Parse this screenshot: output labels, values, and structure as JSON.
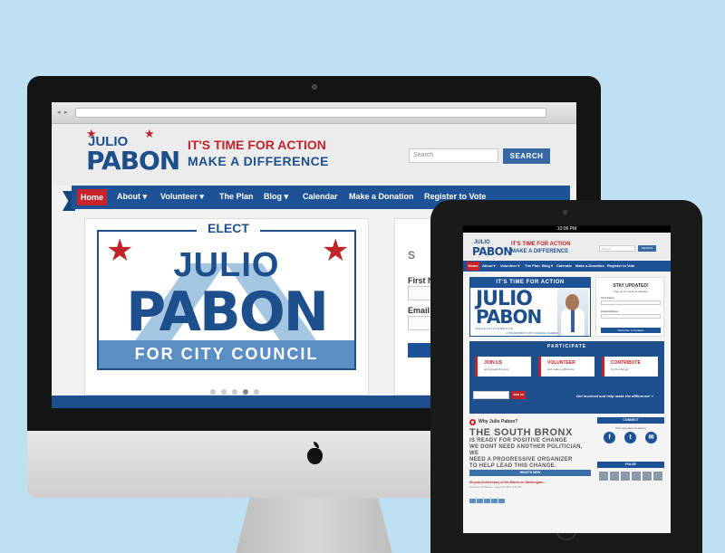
{
  "desktop": {
    "logo": {
      "line1": "JULIO",
      "line2": "PABON"
    },
    "tagline": {
      "line1": "IT'S TIME FOR ACTION",
      "line2": "MAKE A DIFFERENCE"
    },
    "search": {
      "placeholder": "Search",
      "button": "SEARCH"
    },
    "nav": [
      {
        "label": "Home"
      },
      {
        "label": "About ▾"
      },
      {
        "label": "Volunteer ▾"
      },
      {
        "label": "The Plan"
      },
      {
        "label": "Blog ▾"
      },
      {
        "label": "Calendar"
      },
      {
        "label": "Make a Donation"
      },
      {
        "label": "Register to Vote"
      }
    ],
    "hero": {
      "elect": "ELECT",
      "name1": "JULIO",
      "name2": "PABON",
      "council": "FOR CITY COUNCIL"
    },
    "form": {
      "first_name": "First N",
      "email": "Email A",
      "side_initial": "S"
    }
  },
  "tablet": {
    "status_time": "10:06 PM",
    "logo": {
      "line1": "JULIO",
      "line2": "PABON"
    },
    "tagline": {
      "line1": "IT'S TIME FOR ACTION",
      "line2": "MAKE A DIFFERENCE"
    },
    "search": {
      "placeholder": "Search",
      "button": "SEARCH"
    },
    "nav": [
      {
        "label": "Home"
      },
      {
        "label": "About ▾"
      },
      {
        "label": "Volunteer ▾"
      },
      {
        "label": "The Plan"
      },
      {
        "label": "Blog ▾"
      },
      {
        "label": "Calendar"
      },
      {
        "label": "Make a Donation"
      },
      {
        "label": "Register to Vote"
      }
    ],
    "hero": {
      "banner": "IT'S TIME FOR ACTION",
      "name1": "JULIO",
      "name2": "PABON",
      "sub": "M A K E   A   D I F F E R E N C E",
      "candidate": "17TH DISTRICT CITY COUNCIL CANDIDATE"
    },
    "updates": {
      "title": "STAY UPDATED!",
      "subtitle": "Sign up for News & Updates",
      "first_name": "First Name",
      "email": "Email Address",
      "button": "Subscribe to Updates"
    },
    "participate": {
      "title": "PARTICIPATE",
      "cards": [
        {
          "title": "JOIN US",
          "sub": "and spread the word"
        },
        {
          "title": "VOLUNTEER",
          "sub": "and make a difference"
        },
        {
          "title": "CONTRIBUTE",
          "sub": "for the change"
        }
      ],
      "join_button": "JOIN US",
      "involved": "Get involved and help make the difference! »"
    },
    "why": {
      "title": "Why Julio Pabon?",
      "headline": "THE SOUTH BRONX",
      "lines": [
        "IS READY FOR POSITIVE CHANGE",
        "WE DONT NEED ANOTHER POLITICIAN, WE",
        "NEED A PROGRESSIVE ORGANIZER",
        "TO HELP LEAD THIS CHANGE."
      ]
    },
    "whats_new": {
      "title": "WHAT'S NEW",
      "article": "50-year Anniversary of the March on Washington...",
      "meta": "Posted by Sal Rahman · August 28, 2013 11:57 PM"
    },
    "connect": {
      "title": "CONNECT",
      "sub": "Five new ways on saving",
      "icons": [
        "f",
        "t",
        "✉"
      ]
    },
    "pulse": {
      "title": "PULSE"
    }
  }
}
